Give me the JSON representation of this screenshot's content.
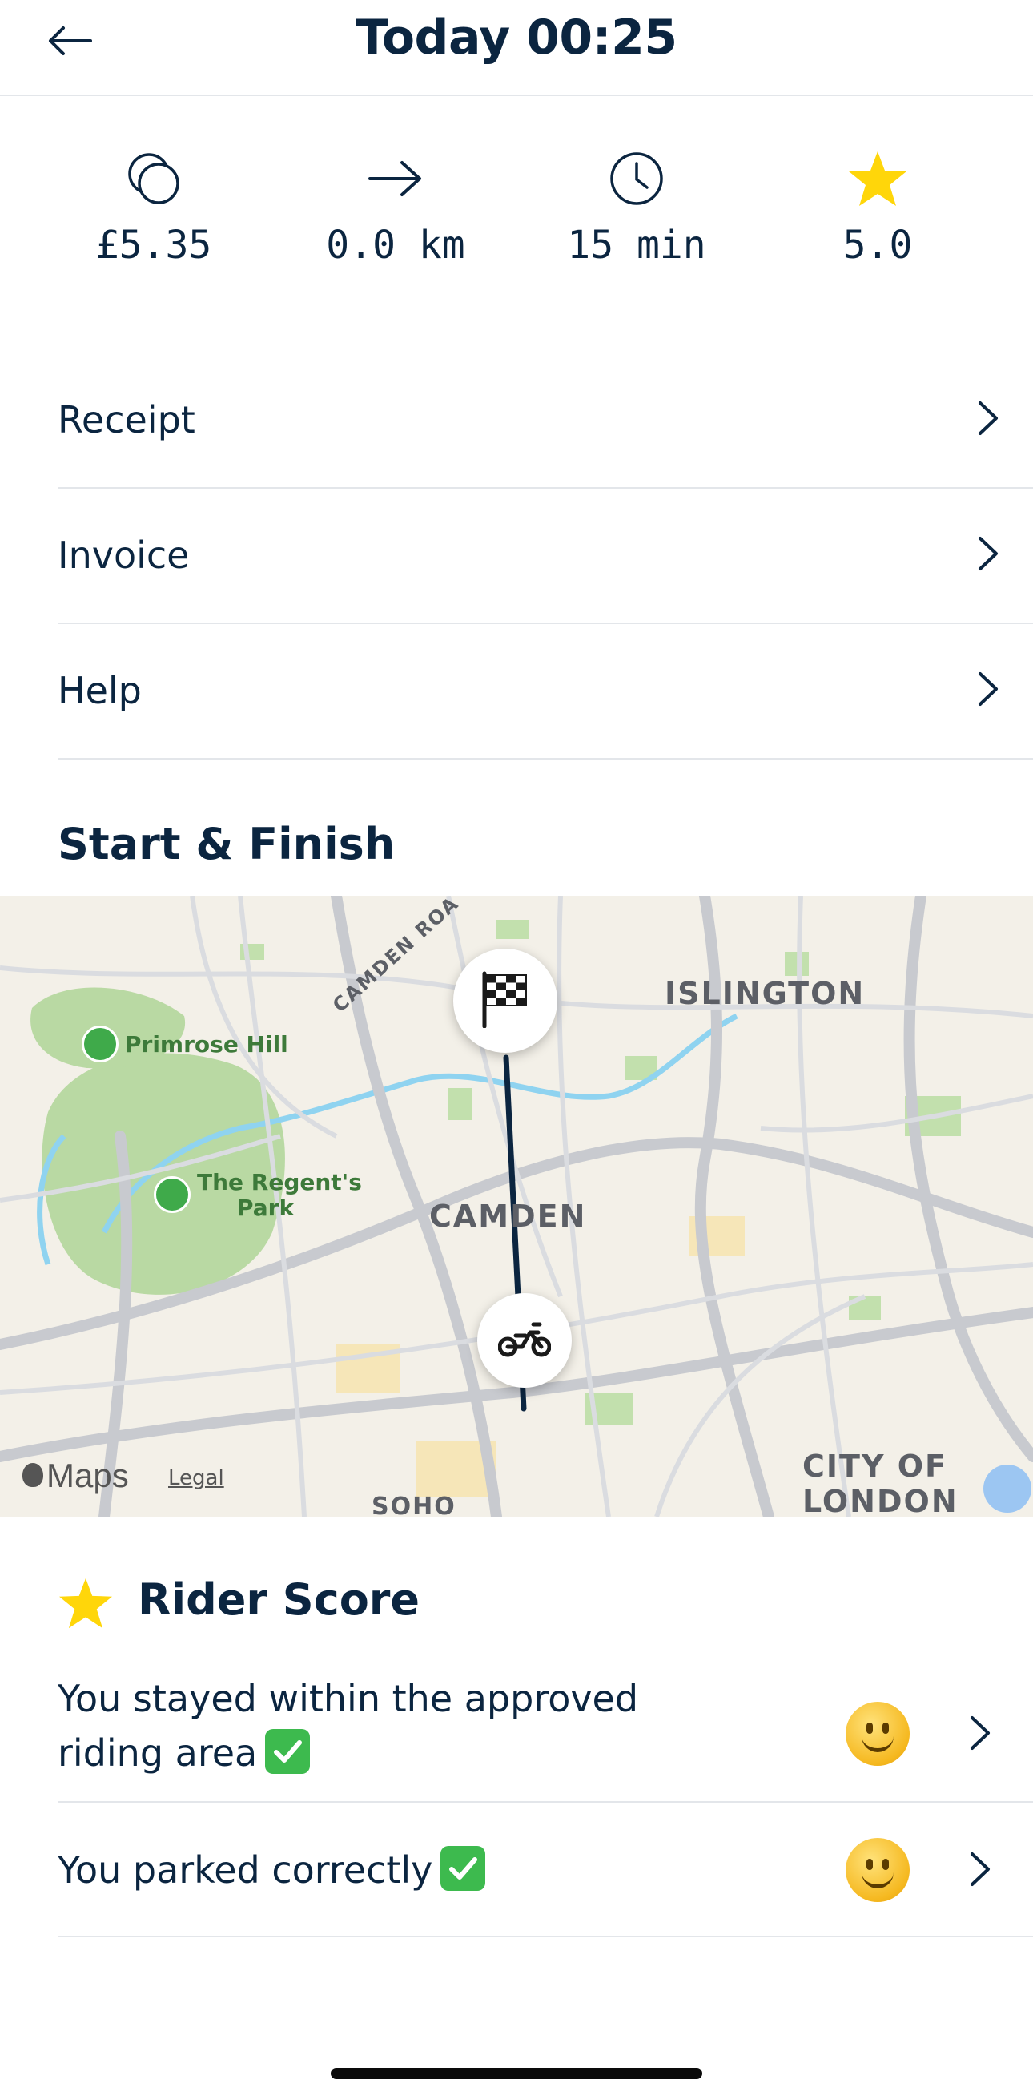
{
  "header": {
    "title": "Today 00:25",
    "back_icon": "arrow-left-icon"
  },
  "stats": [
    {
      "icon": "coins-icon",
      "value": "£5.35"
    },
    {
      "icon": "arrow-right-icon",
      "value": "0.0 km"
    },
    {
      "icon": "clock-icon",
      "value": "15 min"
    },
    {
      "icon": "star-icon",
      "value": "5.0"
    }
  ],
  "menu": [
    {
      "label": "Receipt"
    },
    {
      "label": "Invoice"
    },
    {
      "label": "Help"
    }
  ],
  "start_finish": {
    "title": "Start & Finish"
  },
  "map": {
    "labels": {
      "islington": "ISLINGTON",
      "camden": "CAMDEN",
      "city_of": "CITY OF",
      "london": "LONDON",
      "soho": "SOHO",
      "camden_road": "CAMDEN ROA",
      "primrose_hill": "Primrose Hill",
      "regents_park_1": "The Regent's",
      "regents_park_2": "Park"
    },
    "attribution": "Maps",
    "legal": "Legal"
  },
  "rider_score": {
    "title": "Rider Score",
    "items": [
      {
        "text_line1": "You stayed within the approved",
        "text_line2": "riding area"
      },
      {
        "text_line1": "You parked correctly"
      }
    ]
  },
  "colors": {
    "text": "#0b2540",
    "star": "#ffd60a",
    "divider": "#e3e6ea",
    "route": "#0b2540"
  }
}
